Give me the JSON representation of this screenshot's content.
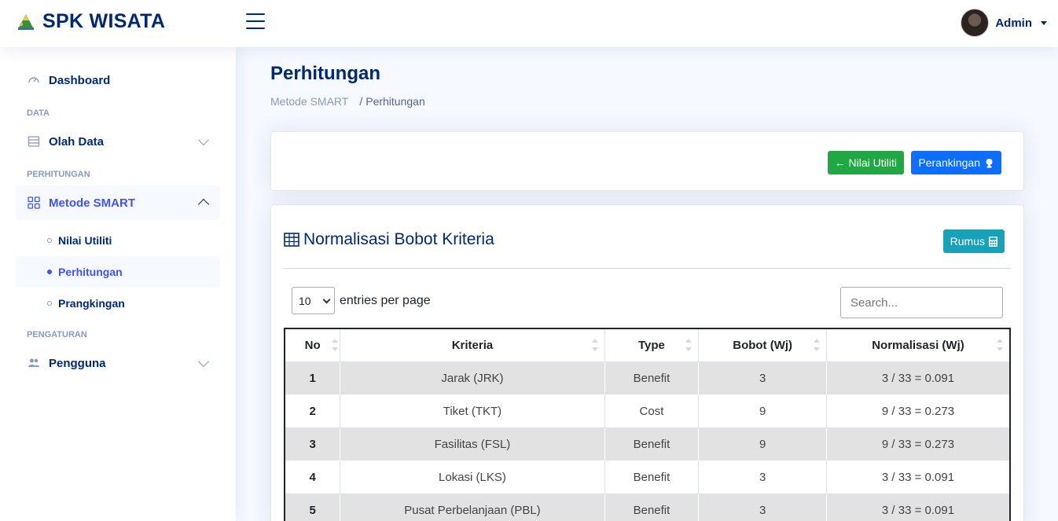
{
  "header": {
    "brand": "SPK WISATA",
    "user_name": "Admin"
  },
  "sidebar": {
    "items": [
      {
        "label": "Dashboard",
        "icon": "gauge-icon"
      },
      {
        "heading": "DATA"
      },
      {
        "label": "Olah Data",
        "icon": "database-icon"
      },
      {
        "heading": "PERHITUNGAN"
      },
      {
        "label": "Metode SMART",
        "icon": "grid-icon",
        "active": true
      },
      {
        "label": "Pengguna",
        "icon": "people-icon"
      }
    ],
    "headings": {
      "data": "DATA",
      "perhitungan": "PERHITUNGAN",
      "pengaturan": "PENGATURAN"
    },
    "dashboard": "Dashboard",
    "olah_data": "Olah Data",
    "metode_smart": "Metode SMART",
    "pengguna": "Pengguna",
    "sub": [
      "Nilai Utiliti",
      "Perhitungan",
      "Prangkingan"
    ]
  },
  "main": {
    "title": "Perhitungan",
    "breadcrumb": [
      "Metode SMART",
      "/",
      "Perhitungan"
    ],
    "btn_back": "← Nilai Utiliti",
    "btn_rank": "Perankingan",
    "card_title": "Normalisasi Bobot Kriteria",
    "btn_rumus": "Rumus",
    "entries_value": "10",
    "entries_label": "entries per page",
    "search_placeholder": "Search..."
  },
  "table": {
    "headers": [
      "No",
      "Kriteria",
      "Type",
      "Bobot (Wj)",
      "Normalisasi (Wj)"
    ],
    "rows": [
      [
        "1",
        "Jarak (JRK)",
        "Benefit",
        "3",
        "3 / 33 = 0.091"
      ],
      [
        "2",
        "Tiket (TKT)",
        "Cost",
        "9",
        "9 / 33 = 0.273"
      ],
      [
        "3",
        "Fasilitas (FSL)",
        "Benefit",
        "9",
        "9 / 33 = 0.273"
      ],
      [
        "4",
        "Lokasi (LKS)",
        "Benefit",
        "3",
        "3 / 33 = 0.091"
      ],
      [
        "5",
        "Pusat Perbelanjaan (PBL)",
        "Benefit",
        "3",
        "3 / 33 = 0.091"
      ]
    ]
  },
  "colors": {
    "brand": "#012970",
    "accent": "#4154f1",
    "green": "#22a745",
    "blue": "#0d6efd",
    "teal": "#17a2b8"
  }
}
